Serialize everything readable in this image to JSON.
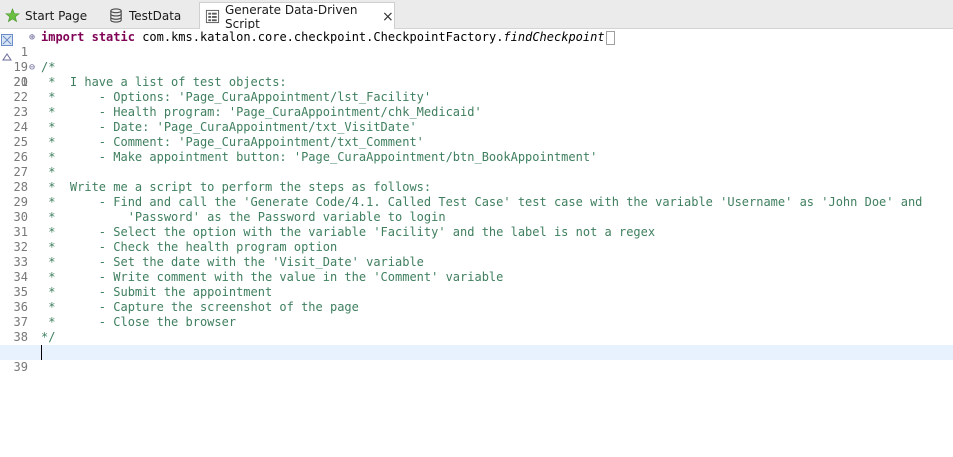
{
  "tabs": [
    {
      "label": "Start Page",
      "icon": "star-icon"
    },
    {
      "label": "TestData",
      "icon": "database-icon"
    },
    {
      "label": "Generate Data-Driven Script",
      "icon": "test-script-icon",
      "active": true,
      "close": "×"
    }
  ],
  "editor": {
    "import_keyword": "import",
    "static_keyword": "static",
    "import_path": "com.kms.katalon.core.checkpoint.CheckpointFactory.",
    "import_method": "findCheckpoint",
    "lines": [
      {
        "num": "1",
        "fold": "⊕"
      },
      {
        "num": "19",
        "fold": ""
      },
      {
        "num": "20",
        "fold": "⊖",
        "text": "/*"
      },
      {
        "num": "21",
        "text": " *  I have a list of test objects:"
      },
      {
        "num": "22",
        "text": " *      - Options: 'Page_CuraAppointment/lst_Facility'"
      },
      {
        "num": "23",
        "text": " *      - Health program: 'Page_CuraAppointment/chk_Medicaid'"
      },
      {
        "num": "24",
        "text": " *      - Date: 'Page_CuraAppointment/txt_VisitDate'"
      },
      {
        "num": "25",
        "text": " *      - Comment: 'Page_CuraAppointment/txt_Comment'"
      },
      {
        "num": "26",
        "text": " *      - Make appointment button: 'Page_CuraAppointment/btn_BookAppointment'"
      },
      {
        "num": "27",
        "text": " *"
      },
      {
        "num": "28",
        "text": " *  Write me a script to perform the steps as follows:"
      },
      {
        "num": "29",
        "text": " *      - Find and call the 'Generate Code/4.1. Called Test Case' test case with the variable 'Username' as 'John Doe' and"
      },
      {
        "num": "30",
        "text": " *          'Password' as the Password variable to login"
      },
      {
        "num": "31",
        "text": " *      - Select the option with the variable 'Facility' and the label is not a regex"
      },
      {
        "num": "32",
        "text": " *      - Check the health program option"
      },
      {
        "num": "33",
        "text": " *      - Set the date with the 'Visit_Date' variable"
      },
      {
        "num": "34",
        "text": " *      - Write comment with the value in the 'Comment' variable"
      },
      {
        "num": "35",
        "text": " *      - Submit the appointment"
      },
      {
        "num": "36",
        "text": " *      - Capture the screenshot of the page"
      },
      {
        "num": "37",
        "text": " *      - Close the browser"
      },
      {
        "num": "38",
        "text": "*/"
      },
      {
        "num": "39",
        "text": ""
      }
    ]
  }
}
